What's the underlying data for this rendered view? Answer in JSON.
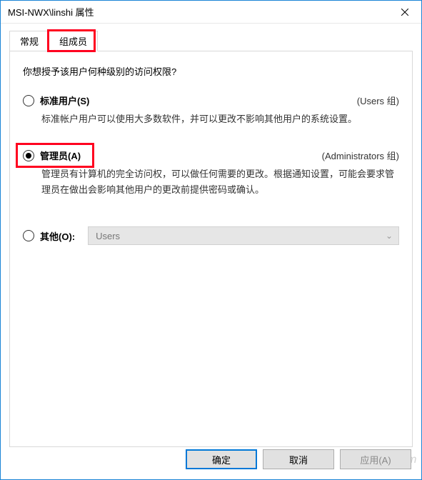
{
  "window": {
    "title": "MSI-NWX\\linshi 属性"
  },
  "tabs": {
    "general": "常规",
    "members": "组成员"
  },
  "question": "你想授予该用户何种级别的访问权限?",
  "options": {
    "standard": {
      "label": "标准用户(S)",
      "group": "(Users 组)",
      "desc": "标准帐户用户可以使用大多数软件，并可以更改不影响其他用户的系统设置。"
    },
    "admin": {
      "label": "管理员(A)",
      "group": "(Administrators 组)",
      "desc": "管理员有计算机的完全访问权，可以做任何需要的更改。根据通知设置，可能会要求管理员在做出会影响其他用户的更改前提供密码或确认。"
    },
    "other": {
      "label": "其他(O):",
      "selected": "Users"
    }
  },
  "buttons": {
    "ok": "确定",
    "cancel": "取消",
    "apply": "应用(A)"
  },
  "watermark": "Yuucn.com"
}
